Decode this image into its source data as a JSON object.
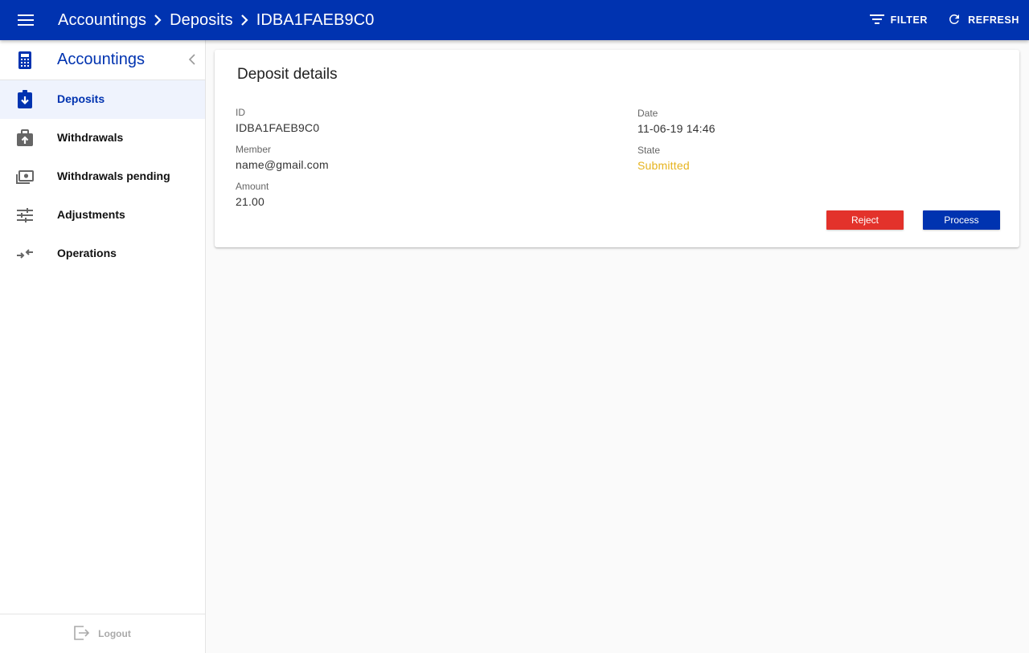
{
  "appbar": {
    "breadcrumb": [
      "Accountings",
      "Deposits",
      "IDBA1FAEB9C0"
    ],
    "filter_label": "FILTER",
    "refresh_label": "REFRESH",
    "color": "#0033b0"
  },
  "sidebar": {
    "title": "Accountings",
    "items": [
      {
        "label": "Deposits",
        "icon": "deposit-icon",
        "active": true
      },
      {
        "label": "Withdrawals",
        "icon": "withdrawal-icon",
        "active": false
      },
      {
        "label": "Withdrawals pending",
        "icon": "money-icon",
        "active": false
      },
      {
        "label": "Adjustments",
        "icon": "tune-icon",
        "active": false
      },
      {
        "label": "Operations",
        "icon": "compare-arrows-icon",
        "active": false
      }
    ],
    "logout_label": "Logout"
  },
  "card": {
    "title": "Deposit details",
    "fields": {
      "id": {
        "label": "ID",
        "value": "IDBA1FAEB9C0"
      },
      "member": {
        "label": "Member",
        "value": "name@gmail.com"
      },
      "amount": {
        "label": "Amount",
        "value": "21.00"
      },
      "date": {
        "label": "Date",
        "value": "11-06-19 14:46"
      },
      "state": {
        "label": "State",
        "value": "Submitted",
        "color": "#e6b31e"
      }
    },
    "reject_label": "Reject",
    "process_label": "Process"
  }
}
